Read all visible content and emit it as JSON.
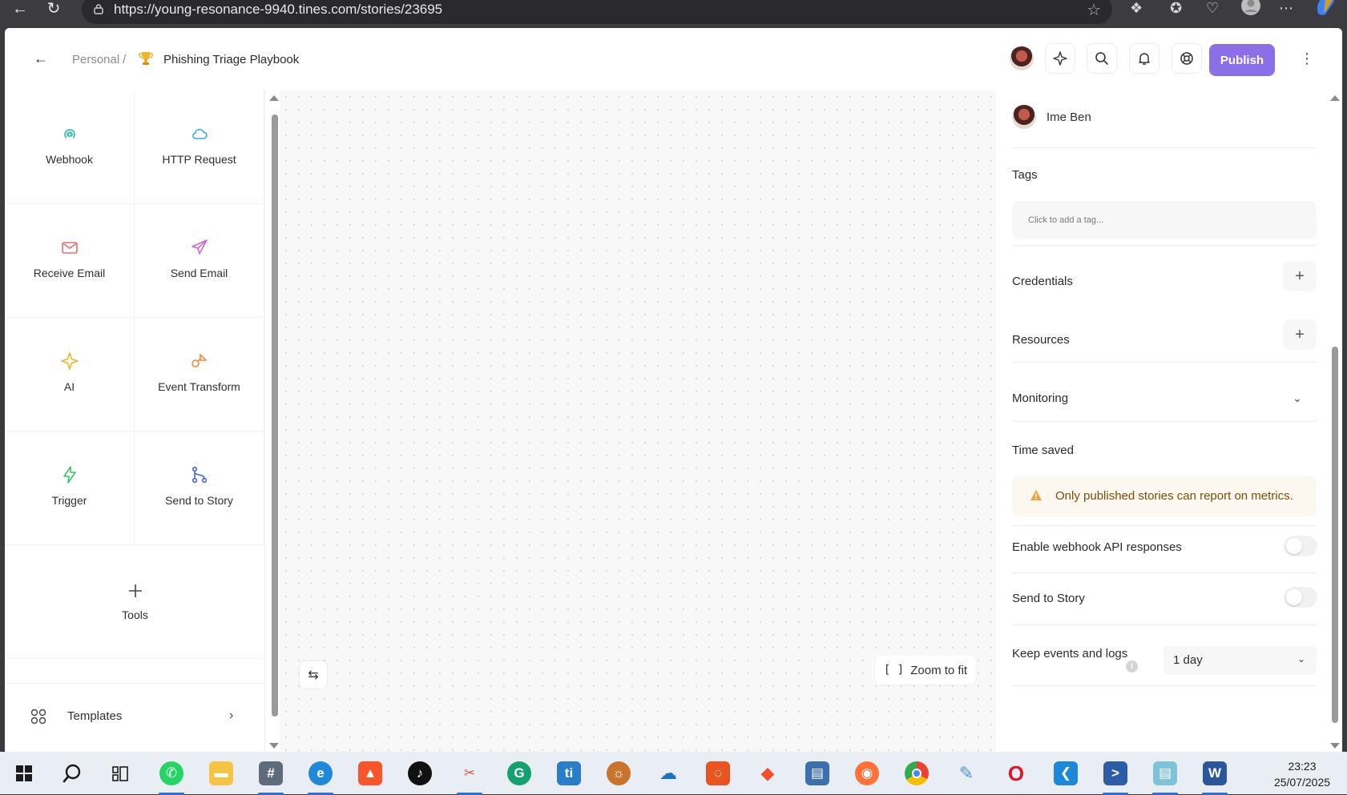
{
  "browser": {
    "url": "https://young-resonance-9940.tines.com/stories/23695"
  },
  "header": {
    "breadcrumb_root": "Personal",
    "breadcrumb_separator": "/",
    "story_title": "Phishing Triage Playbook",
    "publish_label": "Publish"
  },
  "left_panel": {
    "tiles": [
      {
        "label": "Webhook",
        "icon": "webhook-icon",
        "color": "#2fbfa6"
      },
      {
        "label": "HTTP Request",
        "icon": "cloud-icon",
        "color": "#3aa9e0"
      },
      {
        "label": "Receive Email",
        "icon": "mail-icon",
        "color": "#ef6b73"
      },
      {
        "label": "Send Email",
        "icon": "send-icon",
        "color": "#c46bd8"
      },
      {
        "label": "AI",
        "icon": "sparkle-icon",
        "color": "#f2b524"
      },
      {
        "label": "Event Transform",
        "icon": "transform-icon",
        "color": "#f08a3c"
      },
      {
        "label": "Trigger",
        "icon": "bolt-icon",
        "color": "#3cc46a"
      },
      {
        "label": "Send to Story",
        "icon": "branch-icon",
        "color": "#4a63d8"
      }
    ],
    "tools_label": "Tools",
    "templates_label": "Templates"
  },
  "canvas": {
    "zoom_label": "Zoom to fit"
  },
  "right_panel": {
    "owner_name": "Ime Ben",
    "tags_title": "Tags",
    "tags_placeholder": "Click to add a tag...",
    "credentials_title": "Credentials",
    "resources_title": "Resources",
    "monitoring_title": "Monitoring",
    "time_saved_title": "Time saved",
    "time_saved_warning": "Only published stories can report on metrics.",
    "webhook_api_title": "Enable webhook API responses",
    "webhook_api_enabled": false,
    "send_to_story_title": "Send to Story",
    "send_to_story_enabled": false,
    "keep_events_title": "Keep events and logs",
    "keep_events_value": "1 day"
  },
  "colors": {
    "accent": "#8b6fe8",
    "warning_text": "#7a4e08",
    "warning_bg": "#fdf8ef"
  },
  "taskbar": {
    "time": "23:23",
    "date": "25/07/2025",
    "apps": [
      "start-icon",
      "search-icon",
      "task-view-icon",
      "whatsapp-icon",
      "file-explorer-icon",
      "calculator-icon",
      "edge-icon",
      "brave-icon",
      "tiktok-icon",
      "snipping-tool-icon",
      "grammarly-icon",
      "ti-app-icon",
      "app-icon",
      "onedrive-icon",
      "ubuntu-icon",
      "git-icon",
      "network-icon",
      "firefox-icon",
      "chrome-icon",
      "paint-icon",
      "opera-icon",
      "vscode-icon",
      "powershell-icon",
      "notepad-icon",
      "word-icon"
    ]
  }
}
